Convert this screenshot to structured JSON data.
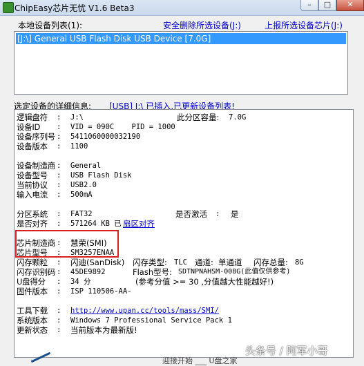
{
  "window": {
    "title": "ChipEasy芯片无忧 V1.6 Beta3",
    "min_label": "–",
    "max_label": "□",
    "close_label": "✕"
  },
  "device_list": {
    "label": "本地设备列表(1):",
    "safe_remove_link": "安全删除所选设备(J:)",
    "report_link": "上报所选设备芯片(J:)",
    "items": [
      "[J:\\] General USB Flash Disk USB Device [7.0G]"
    ]
  },
  "details": {
    "label": "选定设备的详细信息:",
    "status": "[USB] J:\\ 已插入,已更新设备列表!",
    "rows": {
      "logical_drive": {
        "key": "逻辑盘符",
        "sep": ":",
        "value": "J:\\",
        "key2": "此分区容量:",
        "value2": "7.0G"
      },
      "device_id": {
        "key": "设备ID",
        "sep": ":",
        "value": "VID = 090C    PID = 1000"
      },
      "serial": {
        "key": "设备序列号",
        "sep": ":",
        "value": "5411060000032190"
      },
      "version": {
        "key": "设备版本",
        "sep": ":",
        "value": "1100"
      },
      "manufacturer": {
        "key": "设备制造商",
        "sep": ":",
        "value": "General"
      },
      "model": {
        "key": "设备型号",
        "sep": ":",
        "value": "USB Flash Disk"
      },
      "protocol": {
        "key": "当前协议",
        "sep": ":",
        "value": "USB2.0"
      },
      "current": {
        "key": "输入电流",
        "sep": ":",
        "value": "500mA"
      },
      "fs": {
        "key": "分区系统",
        "sep": ":",
        "value": "FAT32",
        "key2": "是否激活",
        "sep2": ":",
        "value2": "是"
      },
      "aligned": {
        "key": "是否对齐",
        "sep": ":",
        "value": "571264 KB 已",
        "link": "扇区对齐"
      },
      "chip_vendor": {
        "key": "芯片制造商",
        "sep": ":",
        "value": "慧荣(SMI)"
      },
      "chip_model": {
        "key": "芯片型号",
        "sep": ":",
        "value": "SM3257ENAA"
      },
      "flash_vendor": {
        "key": "闪存颗粒",
        "sep": ":",
        "value": "闪迪(SanDisk)",
        "k2": "闪存类型:",
        "v2": "TLC",
        "k3": "通道:",
        "v3": "单通道",
        "k4": "闪存总量:",
        "v4": "8G"
      },
      "flash_id": {
        "key": "闪存识别码",
        "sep": ":",
        "value": "45DE9892",
        "k2": "Flash型号:",
        "v2": "SDTNPNAHSM-008G(此值仅供参考)"
      },
      "speed": {
        "key": "U盘得分",
        "sep": ":",
        "value": "34 分",
        "note": "(参考分值 >= 30 ,分值越大性能越好!)"
      },
      "firmware": {
        "key": "固件版本",
        "sep": ":",
        "value": "ISP 110506-AA-"
      },
      "tool": {
        "key": "工具下载",
        "sep": ":",
        "value": "http://www.upan.cc/tools/mass/SMI/"
      },
      "os": {
        "key": "系统版本",
        "sep": ":",
        "value": "Windows 7 Professional Service Pack 1"
      },
      "update": {
        "key": "更新状态",
        "sep": ":",
        "value": "当前版本为最新版!"
      }
    }
  },
  "watermark": "头条号 / 阿军小哥",
  "bottom_partial": "迎接开始    ___  U盘之家",
  "colors": {
    "accent": "#3399ff",
    "link": "#0000cc",
    "highlight_box": "#d81e1e"
  }
}
